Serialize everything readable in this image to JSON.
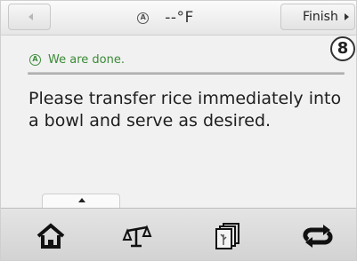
{
  "topbar": {
    "temperature": "--°F",
    "finish_label": "Finish"
  },
  "step": {
    "number": "8"
  },
  "status": {
    "text": "We are done."
  },
  "message": {
    "text": "Please transfer rice immediately into a bowl and serve as desired."
  },
  "icons": {
    "auto": "A"
  },
  "bottom_nav": {
    "items": [
      "home-icon",
      "scale-icon",
      "recipes-icon",
      "repeat-icon"
    ]
  },
  "colors": {
    "status_green": "#3b8a37",
    "background": "#f1f1f1"
  }
}
